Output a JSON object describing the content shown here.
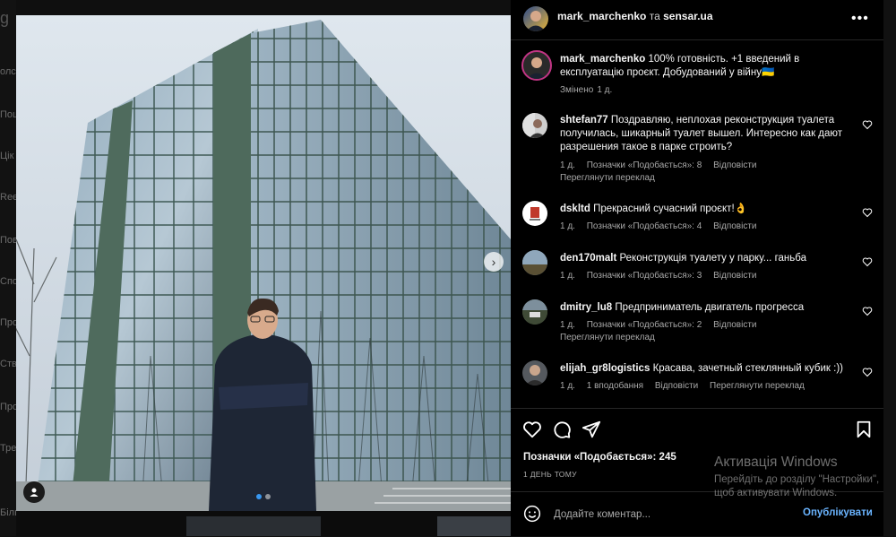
{
  "background": {
    "left_fragments": [
      "олс",
      "Пош",
      "Цік",
      "Reel",
      "Пов",
      "Спо",
      "Про",
      "Ств",
      "Про",
      "Тре",
      "Біль"
    ],
    "top_left_glyph": "g"
  },
  "header": {
    "username": "mark_marchenko",
    "connector": "та",
    "collaborator": "sensar.ua",
    "more_label": "•••"
  },
  "caption": {
    "username": "mark_marchenko",
    "text": "100% готовність. +1 введений в експлуатацію проєкт. Добудований у війну🇺🇦",
    "edited": "Змінено",
    "time": "1 д."
  },
  "comments": [
    {
      "username": "shtefan77",
      "text": "Поздравляю, неплохая реконструкция туалета получилась, шикарный туалет вышел. Интересно как дают разрешения такое в парке строить?",
      "time": "1 д.",
      "likes": "Позначки «Подобається»: 8",
      "reply": "Відповісти",
      "translate": "Переглянути переклад"
    },
    {
      "username": "dskltd",
      "text": "Прекрасний сучасний проєкт!👌",
      "time": "1 д.",
      "likes": "Позначки «Подобається»: 4",
      "reply": "Відповісти"
    },
    {
      "username": "den170malt",
      "text": "Реконструкція туалету у парку... ганьба",
      "time": "1 д.",
      "likes": "Позначки «Подобається»: 3",
      "reply": "Відповісти"
    },
    {
      "username": "dmitry_lu8",
      "text": "Предприниматель двигатель прогресса",
      "time": "1 д.",
      "likes": "Позначки «Подобається»: 2",
      "reply": "Відповісти",
      "translate": "Переглянути переклад"
    },
    {
      "username": "elijah_gr8logistics",
      "text": "Красава, зачетный стеклянный кубик :))",
      "time": "1 д.",
      "likes": "1 вподобання",
      "reply": "Відповісти",
      "translate": "Переглянути переклад"
    }
  ],
  "post": {
    "likes_label": "Позначки «Подобається»: 245",
    "time_ago": "1 ДЕНЬ ТОМУ"
  },
  "add_comment": {
    "placeholder": "Додайте коментар...",
    "publish": "Опублікувати"
  },
  "carousel": {
    "slides": 2,
    "active": 1
  },
  "watermark": {
    "line1": "Активація Windows",
    "line2": "Перейдіть до розділу \"Настройки\", щоб активувати Windows."
  },
  "colors": {
    "accent": "#3897f0",
    "link": "#6ab4ff",
    "muted": "#a8a8a8"
  }
}
